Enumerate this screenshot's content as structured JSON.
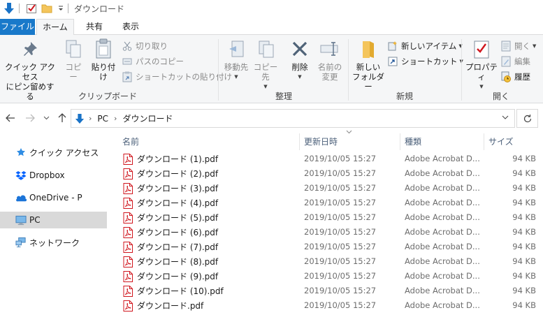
{
  "window": {
    "title": "ダウンロード"
  },
  "ribbon_tabs": {
    "file": "ファイル",
    "home": "ホーム",
    "share": "共有",
    "view": "表示"
  },
  "ribbon": {
    "clipboard": {
      "pin": "クイック アクセス\nにピン留めする",
      "pin_l1": "クイック アクセス",
      "pin_l2": "にピン留めする",
      "copy": "コピー",
      "paste": "貼り付け",
      "cut": "切り取り",
      "copy_path": "パスのコピー",
      "paste_shortcut": "ショートカットの貼り付け",
      "label": "クリップボード"
    },
    "organize": {
      "move_to": "移動先",
      "copy_to": "コピー先",
      "delete": "削除",
      "rename_l1": "名前の",
      "rename_l2": "変更",
      "label": "整理"
    },
    "new": {
      "new_folder_l1": "新しい",
      "new_folder_l2": "フォルダー",
      "new_item": "新しいアイテム",
      "shortcut": "ショートカット",
      "label": "新規"
    },
    "open": {
      "properties": "プロパティ",
      "open": "開く",
      "edit": "編集",
      "history": "履歴",
      "label": "開く"
    }
  },
  "address": {
    "parts": [
      "PC",
      "ダウンロード"
    ]
  },
  "sidebar": {
    "items": [
      {
        "label": "クイック アクセス",
        "icon": "star-icon"
      },
      {
        "label": "Dropbox",
        "icon": "dropbox-icon"
      },
      {
        "label": "OneDrive - P",
        "icon": "onedrive-icon"
      },
      {
        "label": "PC",
        "icon": "pc-icon",
        "selected": true
      },
      {
        "label": "ネットワーク",
        "icon": "network-icon"
      }
    ]
  },
  "columns": {
    "name": "名前",
    "date": "更新日時",
    "type": "種類",
    "size": "サイズ"
  },
  "files": [
    {
      "name": "ダウンロード (1).pdf",
      "date": "2019/10/05 15:27",
      "type": "Adobe Acrobat D...",
      "size": "94 KB"
    },
    {
      "name": "ダウンロード (2).pdf",
      "date": "2019/10/05 15:27",
      "type": "Adobe Acrobat D...",
      "size": "94 KB"
    },
    {
      "name": "ダウンロード (3).pdf",
      "date": "2019/10/05 15:27",
      "type": "Adobe Acrobat D...",
      "size": "94 KB"
    },
    {
      "name": "ダウンロード (4).pdf",
      "date": "2019/10/05 15:27",
      "type": "Adobe Acrobat D...",
      "size": "94 KB"
    },
    {
      "name": "ダウンロード (5).pdf",
      "date": "2019/10/05 15:27",
      "type": "Adobe Acrobat D...",
      "size": "94 KB"
    },
    {
      "name": "ダウンロード (6).pdf",
      "date": "2019/10/05 15:27",
      "type": "Adobe Acrobat D...",
      "size": "94 KB"
    },
    {
      "name": "ダウンロード (7).pdf",
      "date": "2019/10/05 15:27",
      "type": "Adobe Acrobat D...",
      "size": "94 KB"
    },
    {
      "name": "ダウンロード (8).pdf",
      "date": "2019/10/05 15:27",
      "type": "Adobe Acrobat D...",
      "size": "94 KB"
    },
    {
      "name": "ダウンロード (9).pdf",
      "date": "2019/10/05 15:27",
      "type": "Adobe Acrobat D...",
      "size": "94 KB"
    },
    {
      "name": "ダウンロード (10).pdf",
      "date": "2019/10/05 15:27",
      "type": "Adobe Acrobat D...",
      "size": "94 KB"
    },
    {
      "name": "ダウンロード.pdf",
      "date": "2019/10/05 15:27",
      "type": "Adobe Acrobat D...",
      "size": "94 KB"
    }
  ],
  "colors": {
    "accent": "#1979ca",
    "pdf_red": "#d0161e",
    "selected_nav": "#d9d9d9"
  }
}
